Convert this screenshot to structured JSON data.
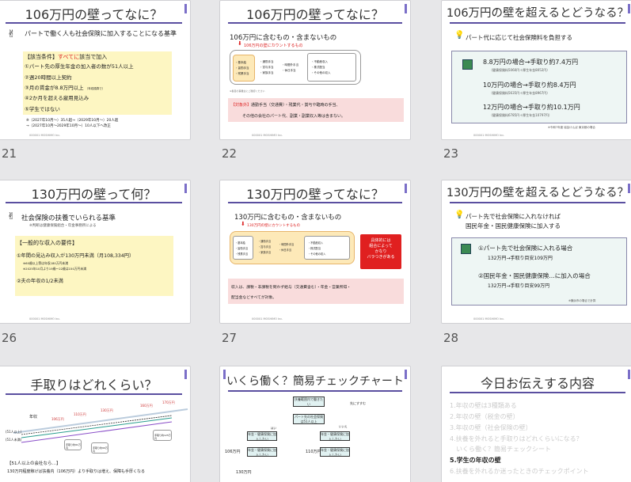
{
  "slides": [
    {
      "num": "21",
      "title": "106万円の壁ってなに？",
      "heading": "パートで働く人も社会保険に加入することになる基準",
      "conditions_label": "【該当条件】",
      "conditions_highlight": "すべてに",
      "conditions_rest": "該当で加入",
      "items": [
        "①パート先の厚生年金の加入者の数が51人以上",
        "②週20時間以上契約",
        "③月の賃金が8.8万円以上",
        "④2か月を超える雇用見込み",
        "⑤学生ではない"
      ],
      "item3_note": "（年収換算で）",
      "foot_notes": [
        "※（2027年10月～）35人超→（2029年10月～）20人超",
        "→（2027年10月～2029年10月～）10人以下へ改正"
      ]
    },
    {
      "num": "22",
      "title": "106万円の壁ってなに？",
      "heading": "106万円に含むもの・含まないもの",
      "red_label": "106万円の壁にカウントするもの",
      "col1": [
        "・基本給",
        "・皆勤手当",
        "・残業手当"
      ],
      "col2": [
        "・通勤手当",
        "・賞与手当",
        "・家族手当"
      ],
      "col3": [
        "・時間外手当",
        "・休日手当"
      ],
      "col4": [
        "・不動産収入",
        "・株式配当",
        "・その他の収入"
      ],
      "note_small": "※各自の事業主にご確認ください",
      "pink_label": "【対象外】",
      "pink_text": "通勤手当（交通費）・残業代・賞与や臨時の手当、",
      "pink_text2": "その他の会社のパート代、副業・副業収入等は含まない。"
    },
    {
      "num": "23",
      "title": "106万円の壁を超えるとどうなる？",
      "heading": "パート代に応じて社会保険料を負担する",
      "rows": [
        {
          "main": "8.8万円の場合→手取り約7.4万円",
          "sub": "（健康保険料5060円＋厚生年金8052円）"
        },
        {
          "main": "10万円の場合→手取り約8.4万円",
          "sub": "（健康保険料5635円＋厚生年金8967円）"
        },
        {
          "main": "12万円の場合→手取り約10.1万円",
          "sub": "（健康保険料6785円＋厚生年金10797円）"
        }
      ],
      "source": "※令和7年度 協会けんぽ 東京都の場合"
    },
    {
      "num": "26",
      "title": "130万円の壁って何？",
      "heading": "社会保険の扶養でいられる基準",
      "sub_heading": "※判断は健康保険組合・年金事務所による",
      "req_label": "【一般的な収入の要件】",
      "req1": "①年間の見込み収入が130万円未満（月108,334円）",
      "req1_note1": "※60歳以上等は年収180万円未満",
      "req1_note2": "※2025年10月より19歳～22歳は150万円未満",
      "req2": "②夫の年収の1/2未満"
    },
    {
      "num": "27",
      "title": "130万円の壁ってなに？",
      "heading": "130万円に含むもの・含まないもの",
      "red_label": "130万円の壁にカウントするもの",
      "col1": [
        "・基本給",
        "・皆勤手当",
        "・残業手当"
      ],
      "col2": [
        "・通勤手当",
        "・賞与手当",
        "・家族手当"
      ],
      "col3": [
        "・時間外手当",
        "・休日手当"
      ],
      "col4": [
        "・不動産収入",
        "・株式配当",
        "・その他の収入"
      ],
      "red_box": [
        "具体的には",
        "組合によって",
        "かなり",
        "バラつきがある"
      ],
      "pink_text": "収入は、課税・非課税を問わず給与（交通費含む）・年金・営業所得・",
      "pink_text2": "配当金などすべてが対象。"
    },
    {
      "num": "28",
      "title": "130万円の壁を超えるとどうなる？",
      "heading": "パート先で社会保険に入れなければ",
      "heading2": "国民年金・国民健康保険に加入する",
      "rows": [
        {
          "main": "①パート先で社会保険に入れる場合",
          "sub": "132万円→手取り目安109万円"
        },
        {
          "main": "②国民年金・国民健康保険…に加入の場合",
          "sub": "132万円→手取り目安99万円"
        }
      ],
      "source": "※横浜市の場合で計算"
    },
    {
      "num": "",
      "title": "手取りはどれくらい？",
      "axis_label": "年収",
      "points": [
        "106万円",
        "110万円",
        "130万円",
        "160万円",
        "170万円"
      ],
      "left_labels": [
        "(51人以上)",
        "(51人未満)"
      ],
      "boxes": [
        "手取り約91万円",
        "手取り約99万円",
        "手取り約125万円"
      ],
      "note_head": "【51人以上の会社なら…】",
      "note_text": "130万円程度稼げば扶養内（106万円）より手取りは増え、保障も手厚くなる"
    },
    {
      "num": "",
      "title": "いくら働く？簡易チェックチャート",
      "nodes": [
        "扶養範囲内で働きたい",
        "パート先の社会保険は51人以上",
        "年金・健康保険に加入したい"
      ],
      "yes_no": [
        "はい",
        "いいえ"
      ],
      "results": [
        "先にすすむ",
        "106万円",
        "110万円",
        "130万円"
      ]
    },
    {
      "num": "",
      "title": "今日お伝えする内容",
      "items": [
        "1.年収の壁は3種類ある",
        "2.年収の壁（税金の壁）",
        "3.年収の壁（社会保険の壁）",
        "4.扶養を外れると手取りはどれくらいになる？",
        "　いくら働く？簡易チェックシート",
        "5.学生の年収の壁",
        "6.扶養を外れるか迷ったときのチェックポイント"
      ]
    }
  ],
  "footer": "000001 MOSHIMO Inc."
}
